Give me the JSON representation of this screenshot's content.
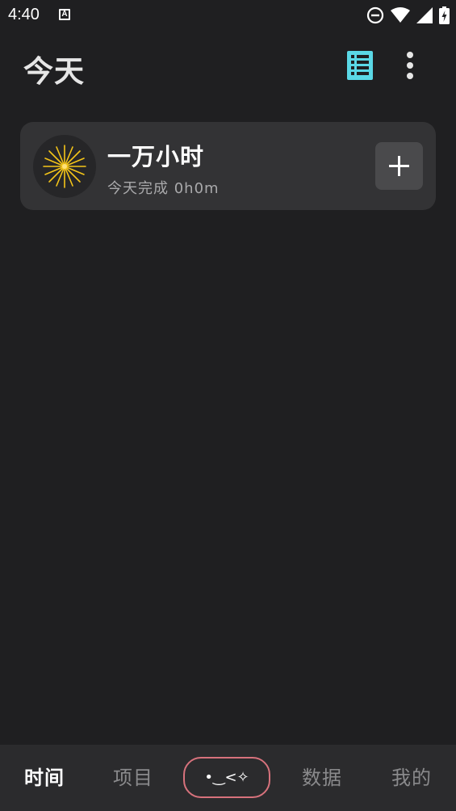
{
  "status_bar": {
    "time": "4:40",
    "app_icon_letter": "A",
    "icons": [
      "do-not-disturb-icon",
      "wifi-icon",
      "signal-icon",
      "battery-charging-icon"
    ]
  },
  "header": {
    "title": "今天",
    "list_icon": "list-view-icon",
    "more_icon": "more-vert-icon",
    "accent_color": "#5ad8e6"
  },
  "projects": [
    {
      "name": "一万小时",
      "subtitle": "今天完成 0h0m",
      "icon": "firework-icon",
      "icon_color": "#f5c518",
      "action_icon": "plus-icon"
    }
  ],
  "bottom_nav": {
    "items": [
      {
        "label": "时间",
        "active": true
      },
      {
        "label": "项目",
        "active": false
      },
      {
        "label": "•‿<✧",
        "active": false
      },
      {
        "label": "数据",
        "active": false
      },
      {
        "label": "我的",
        "active": false
      }
    ],
    "center_border_color": "#d7727c"
  }
}
